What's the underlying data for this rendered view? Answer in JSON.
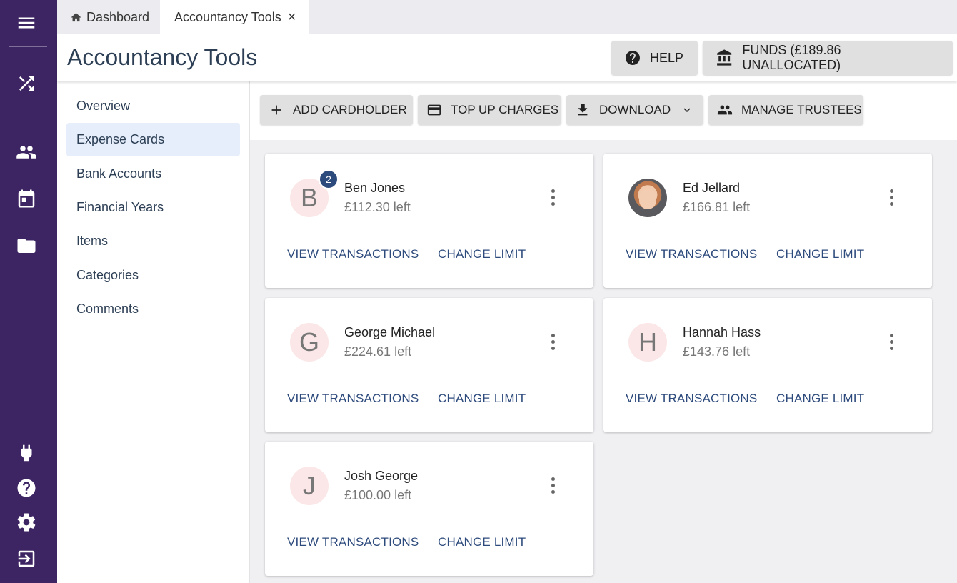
{
  "rail": {
    "top_icons": [
      "menu-icon",
      "shuffle-icon",
      "people-icon",
      "calendar-icon",
      "folder-icon"
    ],
    "bottom_icons": [
      "plug-icon",
      "help-icon",
      "gear-icon",
      "logout-icon"
    ],
    "background": "#3d2463"
  },
  "tabs": [
    {
      "label": "Dashboard",
      "icon": "home-icon"
    },
    {
      "label": "Accountancy Tools",
      "close": "×"
    }
  ],
  "header": {
    "title": "Accountancy Tools",
    "help_label": "HELP",
    "funds_label": "FUNDS (£189.86 UNALLOCATED)"
  },
  "submenu": {
    "items": [
      {
        "label": "Overview"
      },
      {
        "label": "Expense Cards",
        "active": true
      },
      {
        "label": "Bank Accounts"
      },
      {
        "label": "Financial Years"
      },
      {
        "label": "Items"
      },
      {
        "label": "Categories"
      },
      {
        "label": "Comments"
      }
    ]
  },
  "toolbar": {
    "add_cardholder": "ADD CARDHOLDER",
    "top_up_charges": "TOP UP CHARGES",
    "download": "DOWNLOAD",
    "manage_trustees": "MANAGE TRUSTEES"
  },
  "cards": [
    {
      "initial": "B",
      "name": "Ben Jones",
      "amount": "£112.30 left",
      "badge": "2",
      "view": "VIEW TRANSACTIONS",
      "change": "CHANGE LIMIT"
    },
    {
      "initial": "",
      "photo": true,
      "name": "Ed Jellard",
      "amount": "£166.81 left",
      "view": "VIEW TRANSACTIONS",
      "change": "CHANGE LIMIT"
    },
    {
      "initial": "G",
      "name": "George Michael",
      "amount": "£224.61 left",
      "view": "VIEW TRANSACTIONS",
      "change": "CHANGE LIMIT"
    },
    {
      "initial": "H",
      "name": "Hannah Hass",
      "amount": "£143.76 left",
      "view": "VIEW TRANSACTIONS",
      "change": "CHANGE LIMIT"
    },
    {
      "initial": "J",
      "name": "Josh George",
      "amount": "£100.00 left",
      "view": "VIEW TRANSACTIONS",
      "change": "CHANGE LIMIT"
    }
  ],
  "colors": {
    "accent": "#2d4a7c",
    "title": "#2d3f55",
    "active_menu_bg": "#e5eefa",
    "avatar_bg": "#fbe7e7"
  }
}
